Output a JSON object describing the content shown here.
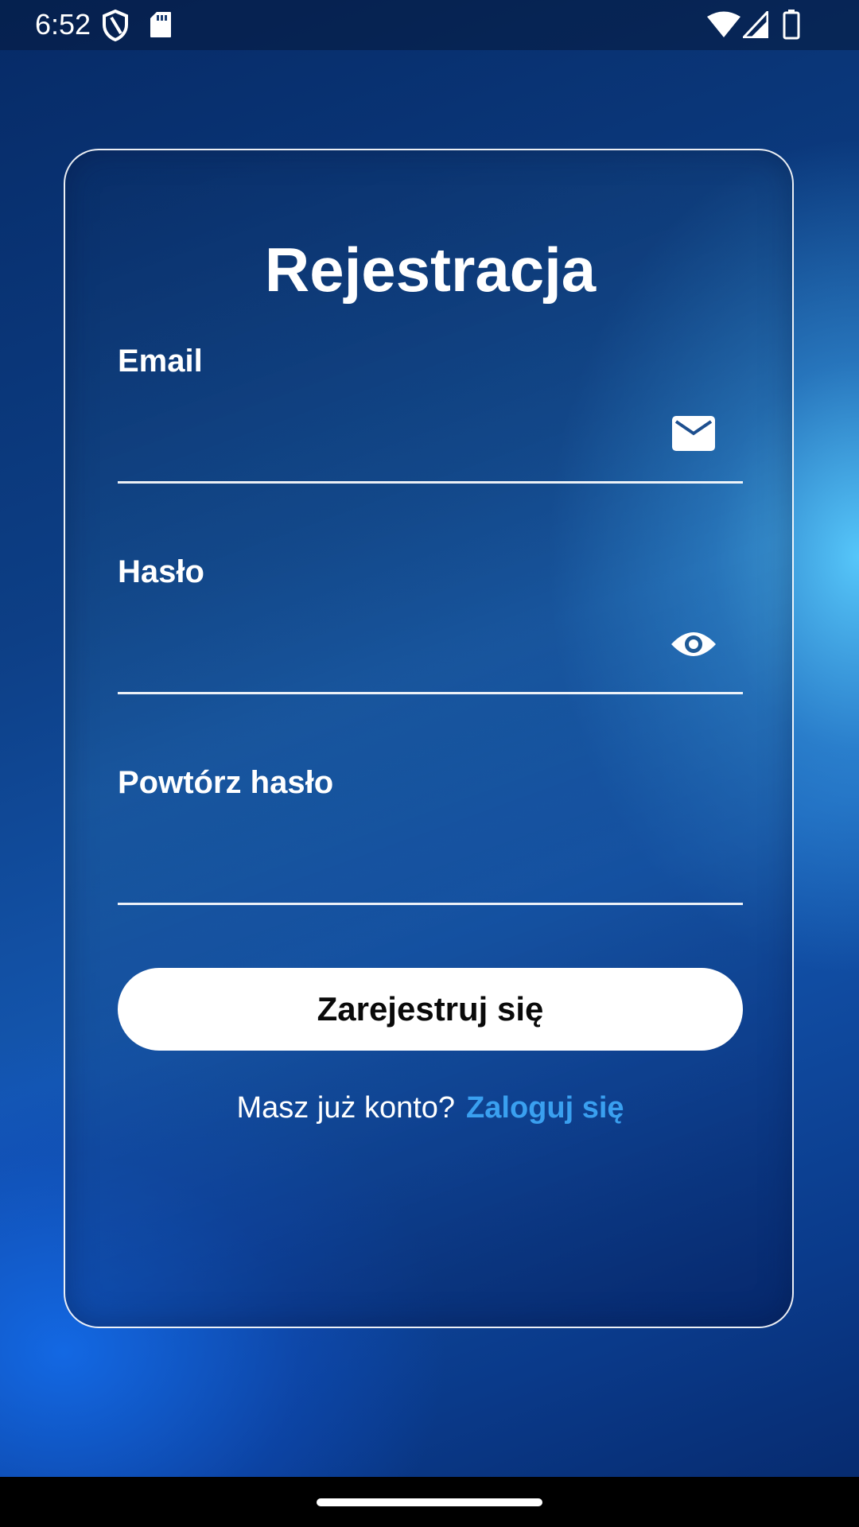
{
  "status_bar": {
    "time": "6:52",
    "icons": [
      "shield-icon",
      "sd-card-icon",
      "wifi-icon",
      "signal-icon",
      "battery-icon"
    ]
  },
  "register_form": {
    "title": "Rejestracja",
    "email": {
      "label": "Email",
      "value": "",
      "icon": "mail-icon"
    },
    "password": {
      "label": "Hasło",
      "value": "",
      "icon": "eye-icon"
    },
    "repeat_password": {
      "label": "Powtórz hasło",
      "value": ""
    },
    "submit_label": "Zarejestruj się",
    "login_prompt": "Masz już konto?",
    "login_link": "Zaloguj się"
  },
  "colors": {
    "background": "#0d3f86",
    "link": "#3aa0f0",
    "button_bg": "#ffffff",
    "button_text": "#0a0a0a"
  }
}
